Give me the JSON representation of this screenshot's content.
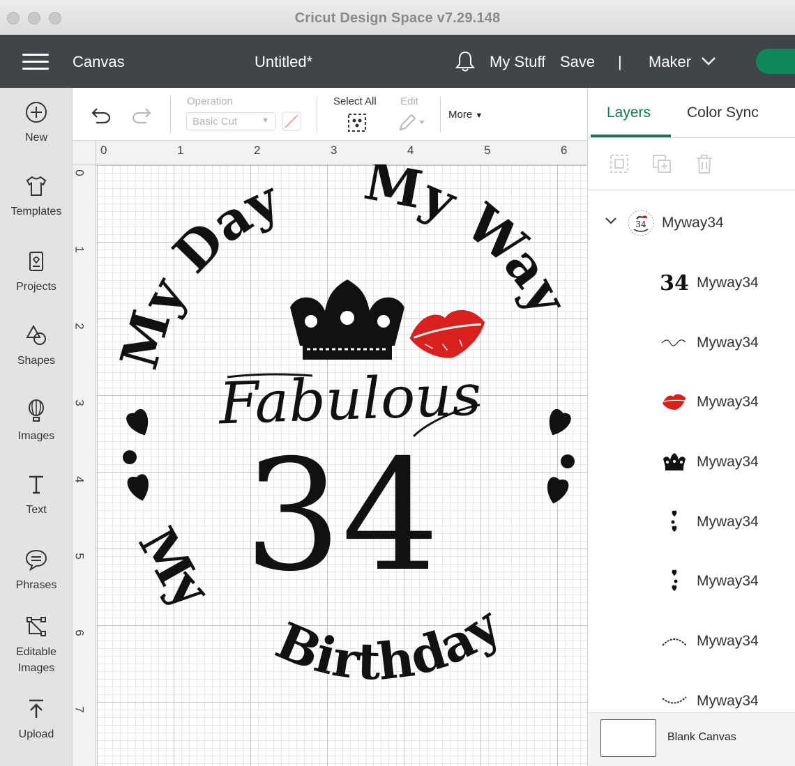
{
  "window": {
    "title": "Cricut Design Space  v7.29.148"
  },
  "header": {
    "canvas_label": "Canvas",
    "doc_title": "Untitled*",
    "my_stuff": "My Stuff",
    "save": "Save",
    "divider": "|",
    "machine": "Maker"
  },
  "sidebar": {
    "new": "New",
    "templates": "Templates",
    "projects": "Projects",
    "shapes": "Shapes",
    "images": "Images",
    "text": "Text",
    "phrases": "Phrases",
    "editable_1": "Editable",
    "editable_2": "Images",
    "upload": "Upload"
  },
  "toolbar": {
    "operation_label": "Operation",
    "operation_value": "Basic Cut",
    "select_all": "Select All",
    "edit": "Edit",
    "more": "More"
  },
  "ruler": {
    "top": [
      "0",
      "1",
      "2",
      "3",
      "4",
      "5",
      "6"
    ],
    "left": [
      "0",
      "1",
      "2",
      "3",
      "4",
      "5",
      "6",
      "7"
    ]
  },
  "design": {
    "top_left": "My Day",
    "top_right": "My Way",
    "script": "Fabulous",
    "number": "34",
    "bottom_left": "My",
    "bottom_right": "Birthday",
    "lips_color": "#d8211f"
  },
  "panel": {
    "tab_layers": "Layers",
    "tab_color_sync": "Color Sync",
    "accent": "#117a52",
    "group_name": "Myway34",
    "layers": [
      {
        "thumb": "34",
        "name": "Myway34"
      },
      {
        "thumb": "script",
        "name": "Myway34"
      },
      {
        "thumb": "lips",
        "name": "Myway34"
      },
      {
        "thumb": "crown",
        "name": "Myway34"
      },
      {
        "thumb": "hearts",
        "name": "Myway34"
      },
      {
        "thumb": "hearts",
        "name": "Myway34"
      },
      {
        "thumb": "arc-top",
        "name": "Myway34"
      },
      {
        "thumb": "arc-bottom",
        "name": "Myway34"
      }
    ],
    "blank_canvas": "Blank Canvas"
  }
}
